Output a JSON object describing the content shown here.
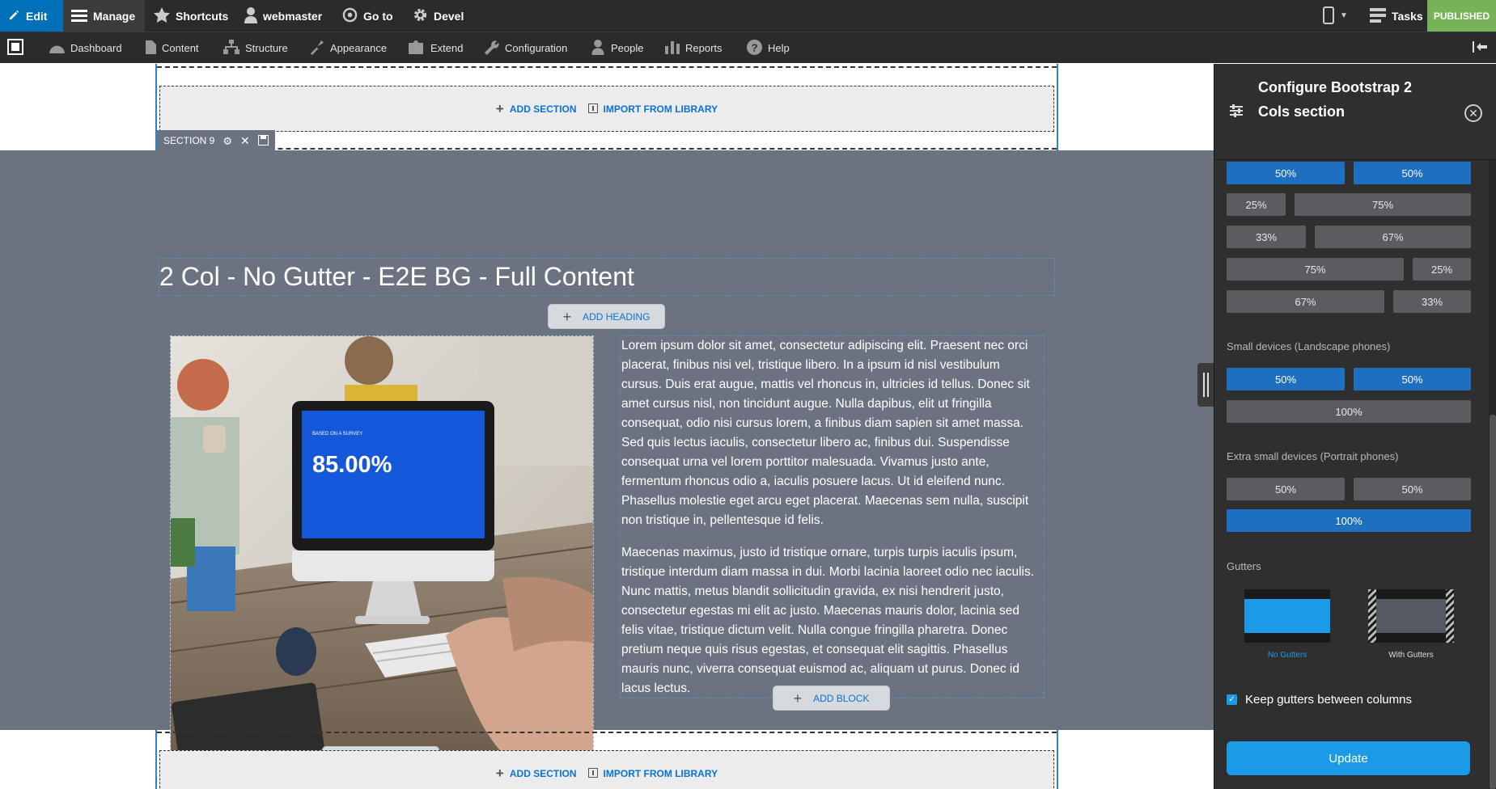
{
  "topbar": {
    "edit": "Edit",
    "manage": "Manage",
    "shortcuts": "Shortcuts",
    "user": "webmaster",
    "goto": "Go to",
    "devel": "Devel",
    "tasks": "Tasks",
    "published": "PUBLISHED"
  },
  "toolbar": {
    "items": [
      "Dashboard",
      "Content",
      "Structure",
      "Appearance",
      "Extend",
      "Configuration",
      "People",
      "Reports",
      "Help"
    ]
  },
  "builder": {
    "add_section": "ADD SECTION",
    "import_library": "IMPORT FROM LIBRARY",
    "section_label": "SECTION 9",
    "heading": "2 Col - No Gutter - E2E BG - Full Content",
    "add_heading": "ADD HEADING",
    "add_block": "ADD BLOCK",
    "image_overlay": {
      "survey": "BASED ON A SURVEY",
      "percent": "85.00%"
    },
    "paragraph1": "Lorem ipsum dolor sit amet, consectetur adipiscing elit. Praesent nec orci placerat, finibus nisi vel, tristique libero. In a ipsum id nisl vestibulum cursus. Duis erat augue, mattis vel rhoncus in, ultricies id tellus. Donec sit amet cursus nisl, non tincidunt augue. Nulla dapibus, elit ut fringilla consequat, odio nisi cursus lorem, a finibus diam sapien sit amet massa. Sed quis lectus iaculis, consectetur libero ac, finibus dui. Suspendisse consequat urna vel lorem porttitor malesuada. Vivamus justo ante, fermentum rhoncus odio a, iaculis posuere lacus. Ut id eleifend nunc. Phasellus molestie eget arcu eget placerat. Maecenas sem nulla, suscipit non tristique in, pellentesque id felis.",
    "paragraph2": "Maecenas maximus, justo id tristique ornare, turpis turpis iaculis ipsum, tristique interdum diam massa in dui. Morbi lacinia laoreet odio nec iaculis. Nunc mattis, metus blandit sollicitudin gravida, ex nisi hendrerit justo, consectetur egestas mi elit ac justo. Maecenas mauris dolor, lacinia sed felis vitae, tristique dictum velit. Nulla congue fringilla pharetra. Donec pretium neque quis risus egestas, et consequat elit sagittis. Phasellus mauris nunc, viverra consequat euismod ac, aliquam ut purus. Donec id lacus lectus."
  },
  "panel": {
    "title": "Configure Bootstrap 2 Cols section",
    "medium_rows": [
      [
        "50%",
        "50%"
      ],
      [
        "25%",
        "75%"
      ],
      [
        "33%",
        "67%"
      ],
      [
        "75%",
        "25%"
      ],
      [
        "67%",
        "33%"
      ]
    ],
    "small_label": "Small devices (Landscape phones)",
    "small_rows": [
      [
        "50%",
        "50%"
      ],
      [
        "100%"
      ]
    ],
    "xs_label": "Extra small devices (Portrait phones)",
    "xs_rows": [
      [
        "50%",
        "50%"
      ],
      [
        "100%"
      ]
    ],
    "gutters_label": "Gutters",
    "no_gutters": "No Gutters",
    "with_gutters": "With Gutters",
    "keep_gutters": "Keep gutters between columns",
    "update": "Update"
  },
  "colors": {
    "accent": "#1f6fc0",
    "section_bg": "#6b7380",
    "published": "#77b259"
  }
}
